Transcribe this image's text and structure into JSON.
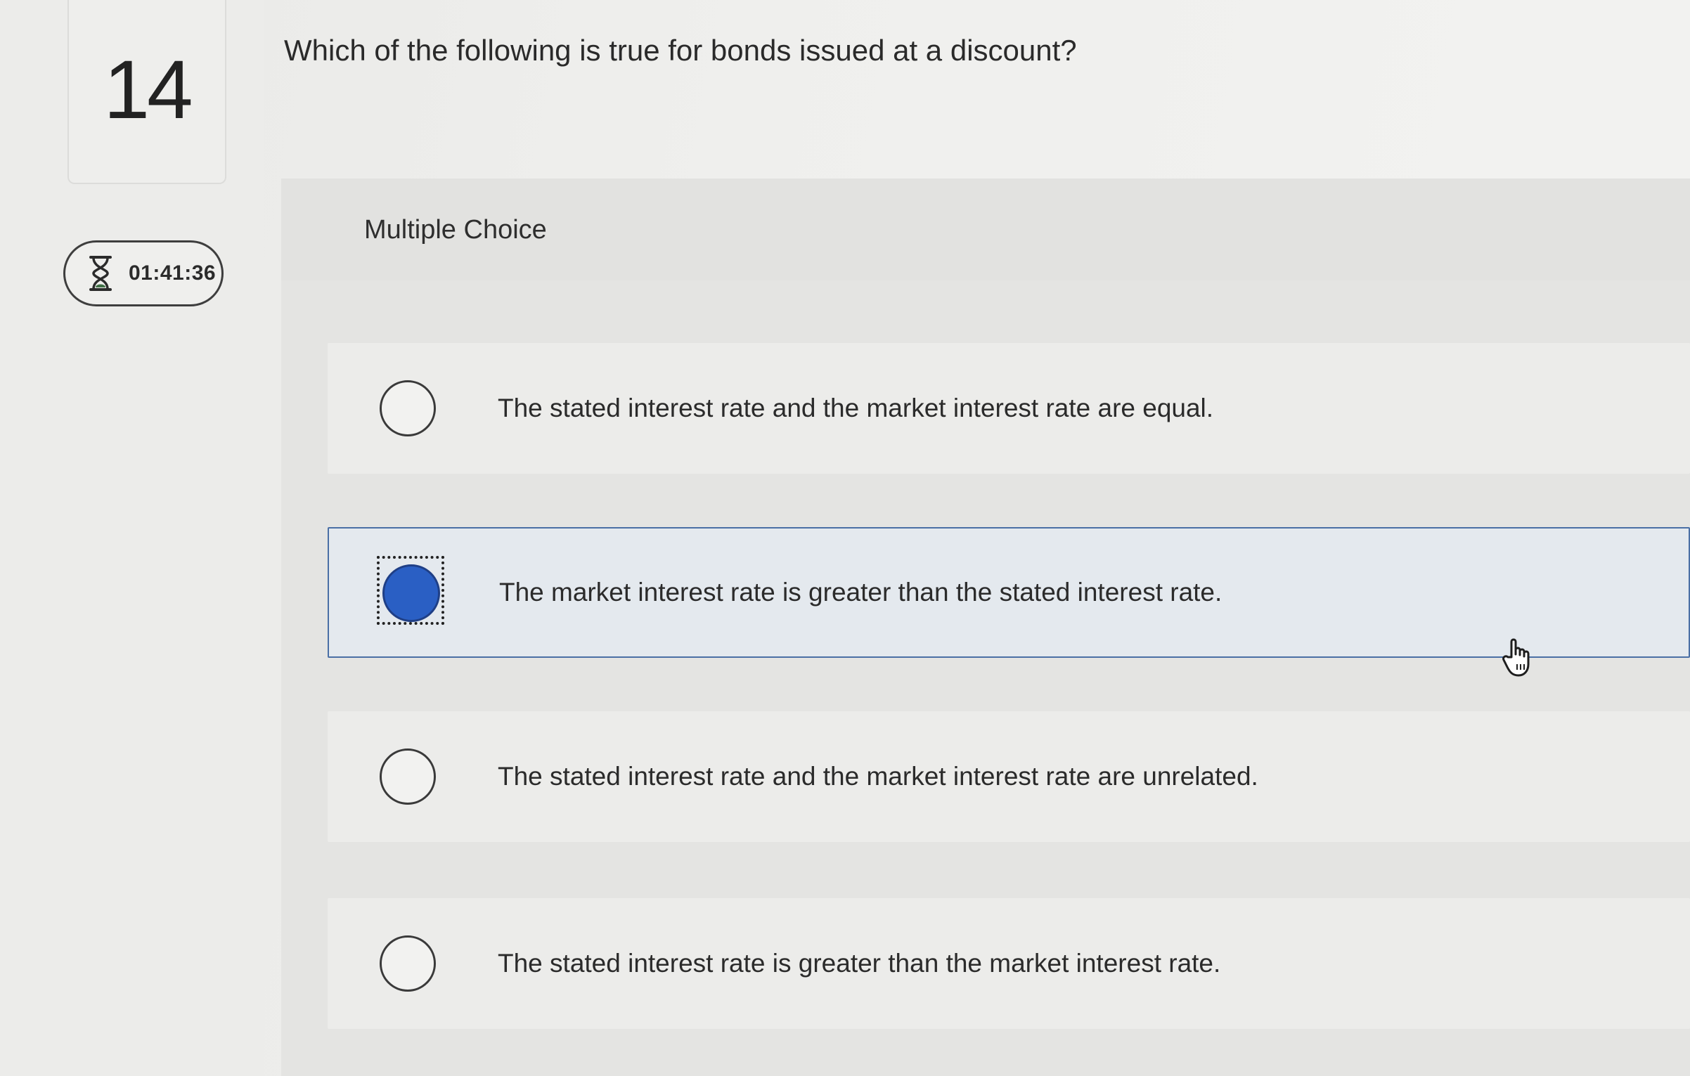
{
  "question": {
    "number": "14",
    "text": "Which of the following is true for bonds issued at a discount?"
  },
  "timer": {
    "icon": "hourglass-icon",
    "value": "01:41:36"
  },
  "answer_section": {
    "type_label": "Multiple Choice",
    "selected_index": 1,
    "options": [
      {
        "label": "The stated interest rate and the market interest rate are equal.",
        "selected": false
      },
      {
        "label": "The market interest rate is greater than the stated interest rate.",
        "selected": true
      },
      {
        "label": "The stated interest rate and the market interest rate are unrelated.",
        "selected": false
      },
      {
        "label": "The stated interest rate is greater than the market interest rate.",
        "selected": false
      }
    ]
  },
  "colors": {
    "selected_fill": "#2a5fc4",
    "selected_border": "#4a6fa5",
    "selected_background": "#e4e9ee"
  },
  "cursor": {
    "icon": "hand-pointer-icon"
  }
}
